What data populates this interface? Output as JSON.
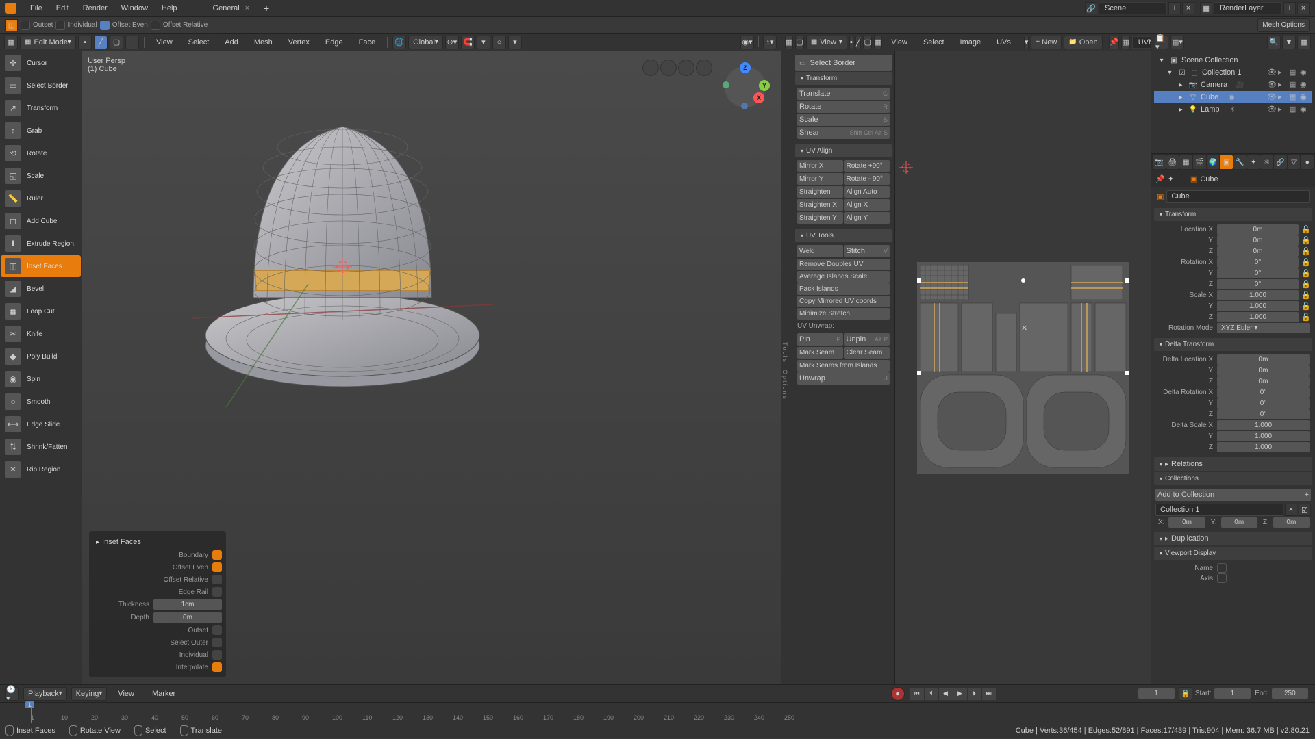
{
  "menubar": {
    "items": [
      "File",
      "Edit",
      "Render",
      "Window",
      "Help"
    ],
    "tabs": {
      "active": "General",
      "close": "×",
      "add": "+"
    },
    "scene_icon": "◉",
    "scene": "Scene",
    "renderlayer": "RenderLayer"
  },
  "toolbar2": {
    "outset": "Outset",
    "individual": "Individual",
    "offset_even": "Offset Even",
    "offset_relative": "Offset Relative",
    "mesh_options": "Mesh Options"
  },
  "header3d": {
    "mode": "Edit Mode",
    "menus": [
      "View",
      "Select",
      "Add",
      "Mesh",
      "Vertex",
      "Edge",
      "Face"
    ],
    "orientation": "Global"
  },
  "uvheader": {
    "menus": [
      "View",
      "Select",
      "Image",
      "UVs"
    ],
    "new": "New",
    "open": "Open",
    "uvmap": "UVMap",
    "view": "View"
  },
  "viewport": {
    "line1": "User Persp",
    "line2": "(1) Cube"
  },
  "tools": [
    {
      "icon": "✛",
      "label": "Cursor"
    },
    {
      "icon": "▭",
      "label": "Select Border"
    },
    {
      "icon": "↗",
      "label": "Transform"
    },
    {
      "icon": "↕",
      "label": "Grab"
    },
    {
      "icon": "⟲",
      "label": "Rotate"
    },
    {
      "icon": "◱",
      "label": "Scale"
    },
    {
      "icon": "📏",
      "label": "Ruler"
    },
    {
      "icon": "◻",
      "label": "Add Cube"
    },
    {
      "icon": "⬆",
      "label": "Extrude Region"
    },
    {
      "icon": "◫",
      "label": "Inset Faces",
      "active": true
    },
    {
      "icon": "◢",
      "label": "Bevel"
    },
    {
      "icon": "▦",
      "label": "Loop Cut"
    },
    {
      "icon": "✂",
      "label": "Knife"
    },
    {
      "icon": "◆",
      "label": "Poly Build"
    },
    {
      "icon": "◉",
      "label": "Spin"
    },
    {
      "icon": "○",
      "label": "Smooth"
    },
    {
      "icon": "⟷",
      "label": "Edge Slide"
    },
    {
      "icon": "⇅",
      "label": "Shrink/Fatten"
    },
    {
      "icon": "✕",
      "label": "Rip Region"
    }
  ],
  "redo": {
    "title": "Inset Faces",
    "rows": [
      {
        "label": "Boundary",
        "check": true
      },
      {
        "label": "Offset Even",
        "check": true
      },
      {
        "label": "Offset Relative",
        "check": false
      },
      {
        "label": "Edge Rail",
        "check": false
      },
      {
        "label": "Thickness",
        "value": "1cm"
      },
      {
        "label": "Depth",
        "value": "0m"
      },
      {
        "label": "Outset",
        "check": false
      },
      {
        "label": "Select Outer",
        "check": false
      },
      {
        "label": "Individual",
        "check": false
      },
      {
        "label": "Interpolate",
        "check": true
      }
    ]
  },
  "uvside": {
    "select_border": "Select Border",
    "transform": {
      "title": "Transform",
      "items": [
        {
          "label": "Translate",
          "key": "G"
        },
        {
          "label": "Rotate",
          "key": "R"
        },
        {
          "label": "Scale",
          "key": "S"
        },
        {
          "label": "Shear",
          "key": "Shift Ctrl Alt S"
        }
      ]
    },
    "uvalign": {
      "title": "UV Align",
      "pairs": [
        [
          "Mirror X",
          "Rotate +90°"
        ],
        [
          "Mirror Y",
          "Rotate - 90°"
        ],
        [
          "Straighten",
          "Align Auto"
        ],
        [
          "Straighten X",
          "Align X"
        ],
        [
          "Straighten Y",
          "Align Y"
        ]
      ]
    },
    "uvtools": {
      "title": "UV Tools",
      "weld": "Weld",
      "stitch": "Stitch",
      "stitch_key": "V",
      "items": [
        "Remove Doubles UV",
        "Average Islands Scale",
        "Pack Islands",
        "Copy Mirrored UV coords",
        "Minimize Stretch"
      ],
      "unwrap_label": "UV Unwrap:",
      "pin": "Pin",
      "pin_key": "P",
      "unpin": "Unpin",
      "unpin_key": "Alt P",
      "mark": "Mark Seam",
      "clear": "Clear Seam",
      "mark_islands": "Mark Seams from Islands",
      "unwrap": "Unwrap",
      "unwrap_key": "U"
    }
  },
  "outliner": {
    "scene": "Scene Collection",
    "col": "Collection 1",
    "items": [
      {
        "icon": "📷",
        "name": "Camera",
        "extra": "🎥"
      },
      {
        "icon": "▽",
        "name": "Cube",
        "extra": "◉",
        "sel": true
      },
      {
        "icon": "💡",
        "name": "Lamp",
        "extra": "☀"
      }
    ]
  },
  "props": {
    "obj": "Cube",
    "cube": "Cube",
    "transform": {
      "title": "Transform",
      "loc": {
        "label": "Location X",
        "y": "Y",
        "z": "Z",
        "vx": "0m",
        "vy": "0m",
        "vz": "0m"
      },
      "rot": {
        "label": "Rotation X",
        "y": "Y",
        "z": "Z",
        "vx": "0°",
        "vy": "0°",
        "vz": "0°"
      },
      "scale": {
        "label": "Scale X",
        "y": "Y",
        "z": "Z",
        "vx": "1.000",
        "vy": "1.000",
        "vz": "1.000"
      },
      "mode": {
        "label": "Rotation Mode",
        "value": "XYZ Euler"
      }
    },
    "delta": {
      "title": "Delta Transform",
      "loc": {
        "label": "Delta Location X",
        "y": "Y",
        "z": "Z",
        "vx": "0m",
        "vy": "0m",
        "vz": "0m"
      },
      "rot": {
        "label": "Delta Rotation X",
        "y": "Y",
        "z": "Z",
        "vx": "0°",
        "vy": "0°",
        "vz": "0°"
      },
      "scale": {
        "label": "Delta Scale X",
        "y": "Y",
        "z": "Z",
        "vx": "1.000",
        "vy": "1.000",
        "vz": "1.000"
      }
    },
    "relations": "Relations",
    "collections": {
      "title": "Collections",
      "add": "Add to Collection",
      "col": "Collection 1",
      "x": "X:",
      "y": "Y:",
      "z": "Z:",
      "vx": "0m",
      "vy": "0m",
      "vz": "0m"
    },
    "duplication": "Duplication",
    "viewport_display": {
      "title": "Viewport Display",
      "name": "Name",
      "axis": "Axis"
    }
  },
  "timeline": {
    "playback": "Playback",
    "keying": "Keying",
    "view": "View",
    "marker": "Marker",
    "frame": "1",
    "start_label": "Start:",
    "start": "1",
    "end_label": "End:",
    "end": "250",
    "marks": [
      1,
      10,
      20,
      30,
      40,
      50,
      60,
      70,
      80,
      90,
      100,
      110,
      120,
      130,
      140,
      150,
      160,
      170,
      180,
      190,
      200,
      210,
      220,
      230,
      240,
      250
    ]
  },
  "statusbar": {
    "inset": "Inset Faces",
    "rotate": "Rotate View",
    "select": "Select",
    "translate": "Translate",
    "stats": "Cube | Verts:36/454 | Edges:52/891 | Faces:17/439 | Tris:904 | Mem: 36.7 MB | v2.80.21"
  }
}
